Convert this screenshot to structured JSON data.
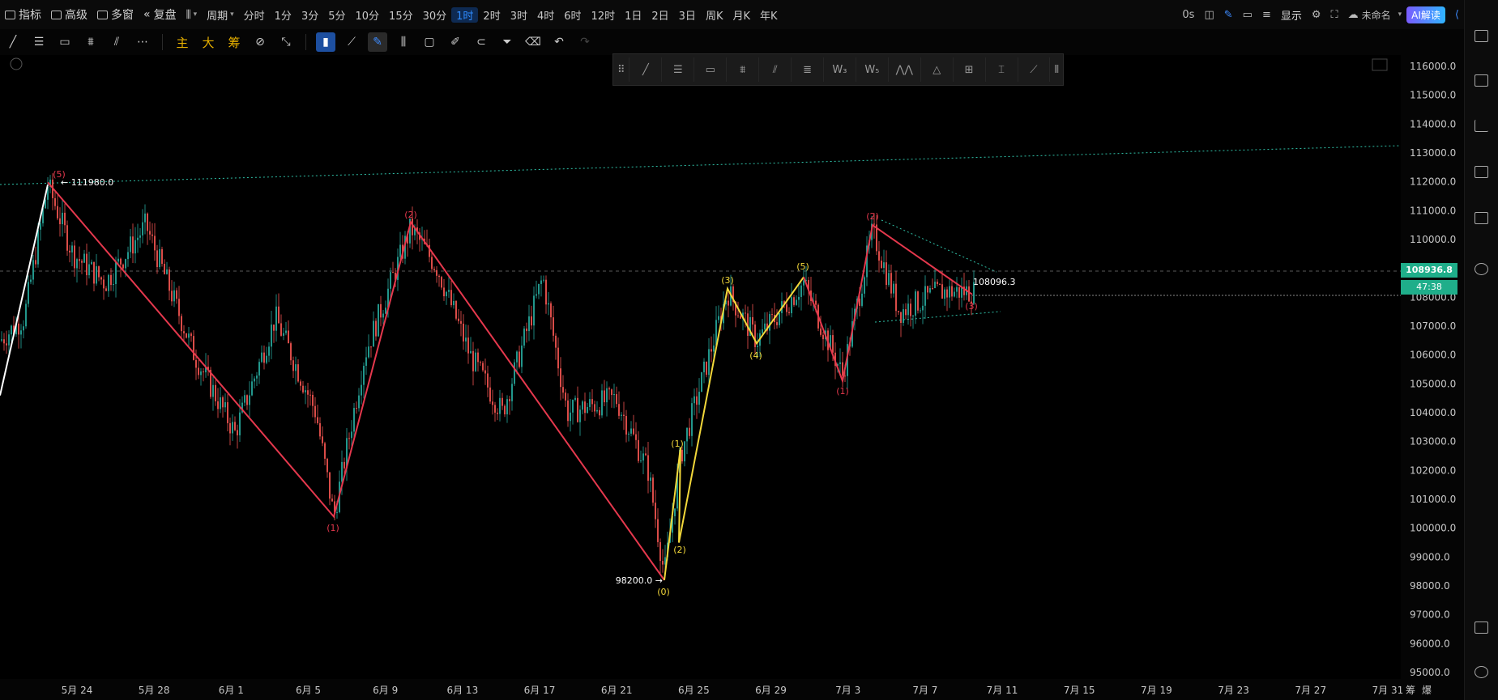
{
  "topbar": {
    "indicator": "指标",
    "advanced": "高级",
    "multi_window": "多窗",
    "replay": "复盘",
    "period": "周期",
    "timeframes": [
      "分时",
      "1分",
      "3分",
      "5分",
      "10分",
      "15分",
      "30分",
      "1时",
      "2时",
      "3时",
      "4时",
      "6时",
      "12时",
      "1日",
      "2日",
      "3日",
      "周K",
      "月K",
      "年K"
    ],
    "active_timeframe": "1时",
    "countdown": "0s",
    "display": "显示",
    "layout_name": "未命名",
    "ai_label": "AI解读"
  },
  "toolbar2": {
    "main_label": "主",
    "big_label": "大",
    "chip_label": "筹"
  },
  "chart": {
    "current_price": "108936.8",
    "countdown_tag": "47:38",
    "price_label_high": "111980.0",
    "price_label_low": "98200.0",
    "price_label_right": "108096.3",
    "wave_labels": {
      "red_5": "(5)",
      "red_1": "(1)",
      "red_2": "(2)",
      "yellow_0": "(0)",
      "yellow_1": "(1)",
      "yellow_2": "(2)",
      "yellow_3": "(3)",
      "yellow_4": "(4)",
      "yellow_5": "(5)",
      "red_1b": "(1)",
      "red_2b": "(2)",
      "red_3b": "(3)"
    },
    "colors": {
      "red_wave": "#e5384d",
      "yellow_wave": "#f2d73a",
      "up_candle": "#26a69a",
      "down_candle": "#ef5350",
      "price_tag": "#1fae8a"
    }
  },
  "chart_data": {
    "type": "candlestick",
    "y_ticks": [
      "116000.0",
      "115000.0",
      "114000.0",
      "113000.0",
      "112000.0",
      "111000.0",
      "110000.0",
      "109000.0",
      "108000.0",
      "107000.0",
      "106000.0",
      "105000.0",
      "104000.0",
      "103000.0",
      "102000.0",
      "101000.0",
      "100000.0",
      "99000.0",
      "98000.0",
      "97000.0",
      "96000.0",
      "95000.0"
    ],
    "x_ticks": [
      "5月 24",
      "5月 28",
      "6月 1",
      "6月 5",
      "6月 9",
      "6月 13",
      "6月 17",
      "6月 21",
      "6月 25",
      "6月 29",
      "7月 3",
      "7月 7",
      "7月 11",
      "7月 15",
      "7月 19",
      "7月 23",
      "7月 27",
      "7月 31"
    ],
    "ylim": [
      95000,
      116000
    ],
    "red_wave_points": [
      [
        59,
        111980
      ],
      [
        412,
        100400
      ],
      [
        507,
        110600
      ],
      [
        820,
        98200
      ]
    ],
    "yellow_wave_points": [
      [
        820,
        98200
      ],
      [
        840,
        102800
      ],
      [
        838,
        99500
      ],
      [
        898,
        108300
      ],
      [
        934,
        106400
      ],
      [
        992,
        108700
      ]
    ],
    "red_wave_points_2": [
      [
        992,
        108700
      ],
      [
        1040,
        105100
      ],
      [
        1077,
        110500
      ],
      [
        1200,
        108100
      ]
    ],
    "axis_tail": [
      "筹",
      "爆"
    ]
  }
}
